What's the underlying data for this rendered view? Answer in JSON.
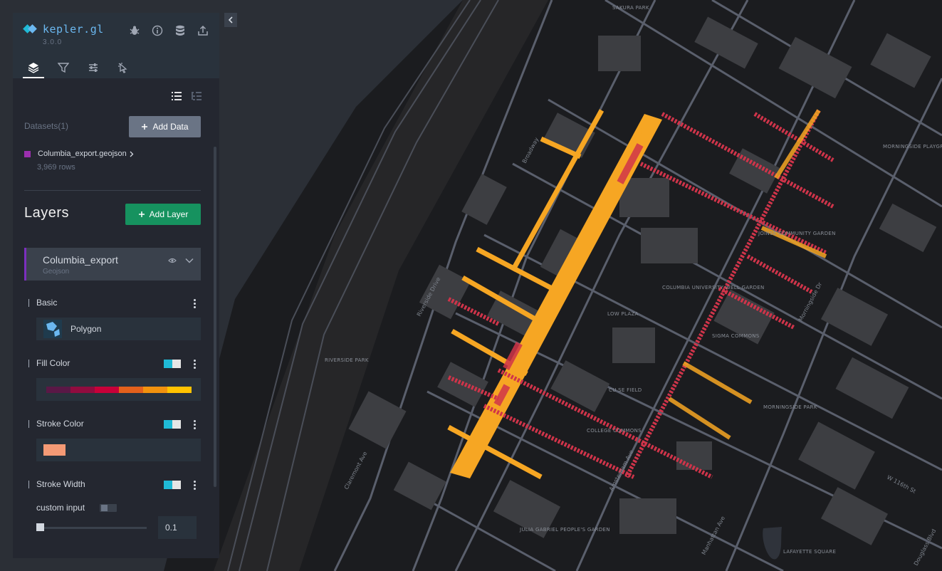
{
  "app": {
    "name": "kepler.gl",
    "version": "3.0.0"
  },
  "header_icons": [
    "bug-icon",
    "info-icon",
    "database-icon",
    "share-icon"
  ],
  "tabs": [
    "layers-icon",
    "filter-icon",
    "sliders-icon",
    "interaction-icon"
  ],
  "datasets": {
    "label": "Datasets(1)",
    "add_label": "Add Data",
    "items": [
      {
        "name": "Columbia_export.geojson",
        "rows": "3,969 rows",
        "color": "#9b2fae"
      }
    ]
  },
  "layers": {
    "title": "Layers",
    "add_label": "Add Layer",
    "items": [
      {
        "name": "Columbia_export",
        "type": "Geojson",
        "accent": "#7b2fbe"
      }
    ]
  },
  "config": {
    "basic_label": "Basic",
    "layer_type": "Polygon",
    "fill_color_label": "Fill Color",
    "fill_ramp": [
      "#5a1846",
      "#900c3f",
      "#c70039",
      "#e3611c",
      "#f1920e",
      "#ffc300"
    ],
    "stroke_color_label": "Stroke Color",
    "stroke_color": "#f49a75",
    "stroke_width_label": "Stroke Width",
    "custom_input_label": "custom input",
    "stroke_width_value": "0.1"
  },
  "map": {
    "place_labels": [
      "SAKURA PARK",
      "RIVERSIDE PARK",
      "LOW PLAZA",
      "CU SE FIELD",
      "COLUMBIA UNIVERSITY WELL GARDEN",
      "MORNINGSIDE PARK",
      "JULIA GABRIEL PEOPLE'S GARDEN",
      "LAFAYETTE SQUARE",
      "MORNINGSIDE PLAYGROUND",
      "JOINSE COMMUNITY GARDEN",
      "COLLEGE COMMONS",
      "SIGMA COMMONS"
    ],
    "road_labels": [
      "Riverside Drive",
      "Morningside Dr",
      "Amsterdam Ave",
      "Claremont Ave",
      "Broadway",
      "W 116th St",
      "Manhattan Ave",
      "Douglass Blvd"
    ]
  },
  "colors": {
    "panel_bg": "#242730",
    "header_bg": "#29323c",
    "accent_green": "#16925f",
    "map_bg": "#2b2f36"
  }
}
